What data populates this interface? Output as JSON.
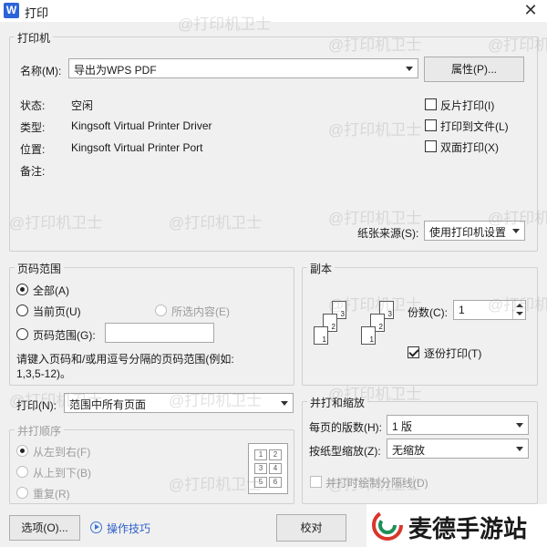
{
  "window": {
    "app_icon_letter": "W",
    "title": "打印"
  },
  "printer": {
    "group_title": "打印机",
    "name_label": "名称(M):",
    "name_value": "导出为WPS PDF",
    "properties_button": "属性(P)...",
    "status_label": "状态:",
    "status_value": "空闲",
    "type_label": "类型:",
    "type_value": "Kingsoft Virtual Printer Driver",
    "location_label": "位置:",
    "location_value": "Kingsoft Virtual Printer Port",
    "comment_label": "备注:",
    "reverse_print": "反片打印(I)",
    "print_to_file": "打印到文件(L)",
    "duplex": "双面打印(X)",
    "paper_source_label": "纸张来源(S):",
    "paper_source_value": "使用打印机设置"
  },
  "page_range": {
    "group_title": "页码范围",
    "all": "全部(A)",
    "current": "当前页(U)",
    "selection": "所选内容(E)",
    "pages": "页码范围(G):",
    "hint_line1": "请键入页码和/或用逗号分隔的页码范围(例如:",
    "hint_line2": "1,3,5-12)。",
    "selected": "all"
  },
  "print_what": {
    "label": "打印(N):",
    "value": "范围中所有页面"
  },
  "collate_order": {
    "group_title": "并打顺序",
    "left_to_right": "从左到右(F)",
    "top_to_bottom": "从上到下(B)",
    "repeat": "重复(R)",
    "grid_numbers": [
      "1",
      "2",
      "3",
      "4",
      "5",
      "6"
    ]
  },
  "copies": {
    "group_title": "副本",
    "count_label": "份数(C):",
    "count_value": "1",
    "collate_label": "逐份打印(T)",
    "collate_checked": true,
    "stack_numbers": [
      "3",
      "2",
      "1"
    ]
  },
  "zoom": {
    "group_title": "并打和缩放",
    "pages_per_sheet_label": "每页的版数(H):",
    "pages_per_sheet_value": "1 版",
    "scale_label": "按纸型缩放(Z):",
    "scale_value": "无缩放",
    "draw_lines": "并打时绘制分隔线(D)"
  },
  "footer": {
    "options_button": "选项(O)...",
    "tips_link": "操作技巧",
    "proofread_button": "校对"
  },
  "watermark": {
    "text": "@打印机卫士"
  },
  "brand": {
    "name": "麦德手游站"
  }
}
